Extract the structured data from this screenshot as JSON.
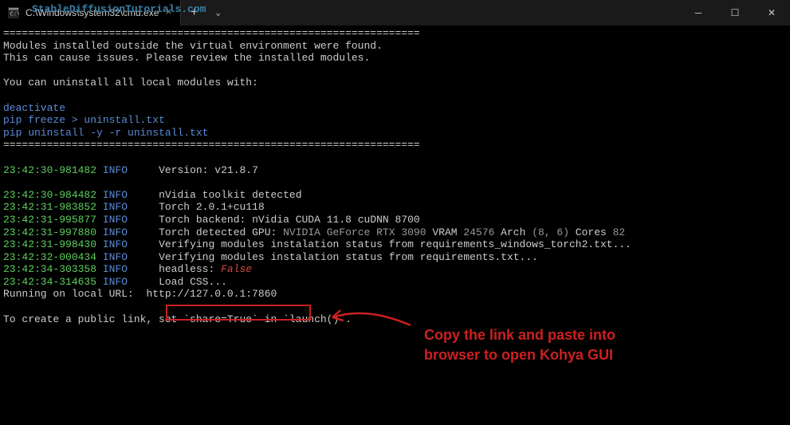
{
  "titlebar": {
    "tab_title": "C:\\Windows\\system32\\cmd.exe",
    "close_label": "×",
    "new_tab": "+",
    "dropdown": "⌄",
    "minimize": "─",
    "maximize": "☐",
    "win_close": "✕"
  },
  "watermark": "StableDiffusionTutorials.com",
  "terminal": {
    "hr": "===================================================================",
    "module_warning1": "Modules installed outside the virtual environment were found.",
    "module_warning2": "This can cause issues. Please review the installed modules.",
    "uninstall_hint": "You can uninstall all local modules with:",
    "cmd1": "deactivate",
    "cmd2": "pip freeze > uninstall.txt",
    "cmd3": "pip uninstall -y -r uninstall.txt",
    "logs": [
      {
        "ts": "23:42:30-981482",
        "level": "INFO",
        "msg": "Version: v21.8.7"
      },
      {
        "ts": "23:42:30-984482",
        "level": "INFO",
        "msg": "nVidia toolkit detected"
      },
      {
        "ts": "23:42:31-983852",
        "level": "INFO",
        "msg": "Torch 2.0.1+cu118"
      },
      {
        "ts": "23:42:31-995877",
        "level": "INFO",
        "msg": "Torch backend: nVidia CUDA 11.8 cuDNN 8700"
      },
      {
        "ts": "23:42:31-997880",
        "level": "INFO",
        "msg_parts": [
          {
            "t": "Torch detected GPU: ",
            "c": "white"
          },
          {
            "t": "NVIDIA GeForce RTX 3090",
            "c": "gray"
          },
          {
            "t": " VRAM ",
            "c": "white"
          },
          {
            "t": "24576",
            "c": "gray"
          },
          {
            "t": " Arch ",
            "c": "white"
          },
          {
            "t": "(8, 6)",
            "c": "gray"
          },
          {
            "t": " Cores ",
            "c": "white"
          },
          {
            "t": "82",
            "c": "gray"
          }
        ]
      },
      {
        "ts": "23:42:31-998430",
        "level": "INFO",
        "msg": "Verifying modules instalation status from requirements_windows_torch2.txt..."
      },
      {
        "ts": "23:42:32-000434",
        "level": "INFO",
        "msg": "Verifying modules instalation status from requirements.txt..."
      },
      {
        "ts": "23:42:34-303358",
        "level": "INFO",
        "msg_parts": [
          {
            "t": "headless: ",
            "c": "white"
          },
          {
            "t": "False",
            "c": "red-italic"
          }
        ]
      },
      {
        "ts": "23:42:34-314635",
        "level": "INFO",
        "msg": "Load CSS..."
      }
    ],
    "running_prefix": "Running on local URL:  ",
    "running_url": "http://127.0.0.1:7860",
    "public_link_hint": "To create a public link, set `share=True` in `launch()`."
  },
  "annotation": {
    "line1": "Copy the link and paste into",
    "line2": "browser to open Kohya GUI"
  }
}
